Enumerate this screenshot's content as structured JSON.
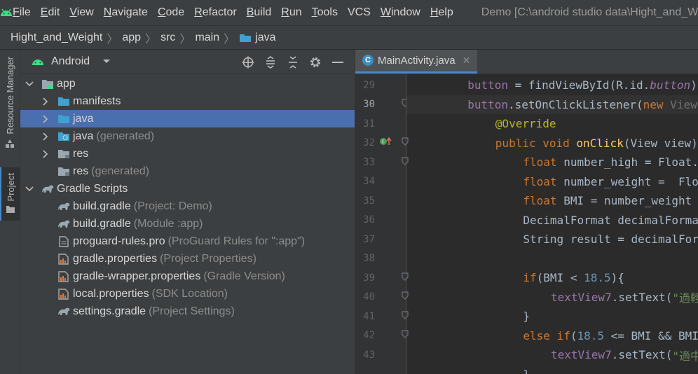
{
  "menu": {
    "items": [
      {
        "u": "F",
        "rest": "ile"
      },
      {
        "u": "E",
        "rest": "dit"
      },
      {
        "u": "V",
        "rest": "iew"
      },
      {
        "u": "N",
        "rest": "avigate"
      },
      {
        "u": "C",
        "rest": "ode"
      },
      {
        "u": "R",
        "rest": "efactor"
      },
      {
        "u": "B",
        "rest": "uild"
      },
      {
        "u": "R",
        "rest": "un"
      },
      {
        "u": "T",
        "rest": "ools"
      },
      {
        "u": "",
        "rest": "VCS"
      },
      {
        "u": "W",
        "rest": "indow"
      },
      {
        "u": "H",
        "rest": "elp"
      }
    ],
    "window_title": "Demo [C:\\android studio data\\Hight_and_Weight]"
  },
  "breadcrumb": [
    "Hight_and_Weight",
    "app",
    "src",
    "main",
    "java"
  ],
  "left_strip": {
    "resource_manager": "Resource Manager",
    "project": "Project"
  },
  "project_panel": {
    "view_title": "Android",
    "tree": [
      {
        "label": "app",
        "hint": "",
        "arrow": "down",
        "icon": "module-icon",
        "indent": 0
      },
      {
        "label": "manifests",
        "hint": "",
        "arrow": "right",
        "icon": "folder-icon",
        "indent": 1
      },
      {
        "label": "java",
        "hint": "",
        "arrow": "right",
        "icon": "folder-icon",
        "indent": 1,
        "selected": true
      },
      {
        "label": "java",
        "hint": "(generated)",
        "arrow": "right",
        "icon": "generated-folder-icon",
        "indent": 1
      },
      {
        "label": "res",
        "hint": "",
        "arrow": "right",
        "icon": "res-folder-icon",
        "indent": 1
      },
      {
        "label": "res",
        "hint": "(generated)",
        "arrow": "",
        "icon": "res-folder-icon",
        "indent": 1
      },
      {
        "label": "Gradle Scripts",
        "hint": "",
        "arrow": "down",
        "icon": "gradle-icon",
        "indent": 0
      },
      {
        "label": "build.gradle",
        "hint": "(Project: Demo)",
        "arrow": "",
        "icon": "gradle-icon",
        "indent": 1
      },
      {
        "label": "build.gradle",
        "hint": "(Module :app)",
        "arrow": "",
        "icon": "gradle-icon",
        "indent": 1
      },
      {
        "label": "proguard-rules.pro",
        "hint": "(ProGuard Rules for \":app\")",
        "arrow": "",
        "icon": "text-file-icon",
        "indent": 1
      },
      {
        "label": "gradle.properties",
        "hint": "(Project Properties)",
        "arrow": "",
        "icon": "properties-file-icon",
        "indent": 1
      },
      {
        "label": "gradle-wrapper.properties",
        "hint": "(Gradle Version)",
        "arrow": "",
        "icon": "properties-file-icon",
        "indent": 1
      },
      {
        "label": "local.properties",
        "hint": "(SDK Location)",
        "arrow": "",
        "icon": "properties-file-icon",
        "indent": 1
      },
      {
        "label": "settings.gradle",
        "hint": "(Project Settings)",
        "arrow": "",
        "icon": "gradle-icon",
        "indent": 1
      }
    ]
  },
  "editor": {
    "tab_label": "MainActivity.java",
    "tab_letter": "C",
    "current_line": 30,
    "lines": [
      {
        "n": "29",
        "indent": 8,
        "tokens": [
          [
            "fld",
            "button"
          ],
          [
            "p",
            " = findViewById(R.id."
          ],
          [
            "fld-it",
            "button"
          ],
          [
            "p",
            ");"
          ]
        ]
      },
      {
        "n": "30",
        "indent": 8,
        "tokens": [
          [
            "fld",
            "button"
          ],
          [
            "p",
            ".setOnClickListener("
          ],
          [
            "kw",
            "new"
          ],
          [
            "gray",
            " View.OnClickListener() {"
          ]
        ]
      },
      {
        "n": "31",
        "indent": 12,
        "tokens": [
          [
            "ann",
            "@Override"
          ]
        ]
      },
      {
        "n": "32",
        "indent": 12,
        "tokens": [
          [
            "kw",
            "public void "
          ],
          [
            "mth",
            "onClick"
          ],
          [
            "p",
            "(View view) {"
          ]
        ]
      },
      {
        "n": "33",
        "indent": 16,
        "tokens": [
          [
            "kw",
            "float "
          ],
          [
            "p",
            "number_high = Float."
          ]
        ]
      },
      {
        "n": "34",
        "indent": 16,
        "tokens": [
          [
            "kw",
            "float "
          ],
          [
            "p",
            "number_weight =  Float."
          ]
        ]
      },
      {
        "n": "35",
        "indent": 16,
        "tokens": [
          [
            "kw",
            "float "
          ],
          [
            "p",
            "BMI = number_weight /"
          ]
        ]
      },
      {
        "n": "36",
        "indent": 16,
        "tokens": [
          [
            "p",
            "DecimalFormat decimalFormat"
          ]
        ]
      },
      {
        "n": "37",
        "indent": 16,
        "tokens": [
          [
            "p",
            "String result = decimalFormat"
          ]
        ]
      },
      {
        "n": "38",
        "indent": 0,
        "tokens": []
      },
      {
        "n": "39",
        "indent": 16,
        "tokens": [
          [
            "kw",
            "if"
          ],
          [
            "p",
            "(BMI < "
          ],
          [
            "num-lit",
            "18.5"
          ],
          [
            "p",
            ")"
          ],
          [
            "p",
            "{"
          ]
        ]
      },
      {
        "n": "40",
        "indent": 20,
        "tokens": [
          [
            "fld",
            "textView7"
          ],
          [
            "p",
            ".setText("
          ],
          [
            "str",
            "\"過輕\""
          ]
        ]
      },
      {
        "n": "41",
        "indent": 16,
        "tokens": [
          [
            "p",
            "}"
          ]
        ]
      },
      {
        "n": "42",
        "indent": 16,
        "tokens": [
          [
            "kw",
            "else if"
          ],
          [
            "p",
            "("
          ],
          [
            "num-lit",
            "18.5"
          ],
          [
            "p",
            " <= BMI && BMI"
          ]
        ]
      },
      {
        "n": "43",
        "indent": 20,
        "tokens": [
          [
            "fld",
            "textView7"
          ],
          [
            "p",
            ".setText("
          ],
          [
            "str",
            "\"適中\""
          ]
        ]
      },
      {
        "n": "",
        "indent": 16,
        "tokens": [
          [
            "p",
            "}"
          ]
        ]
      }
    ]
  }
}
